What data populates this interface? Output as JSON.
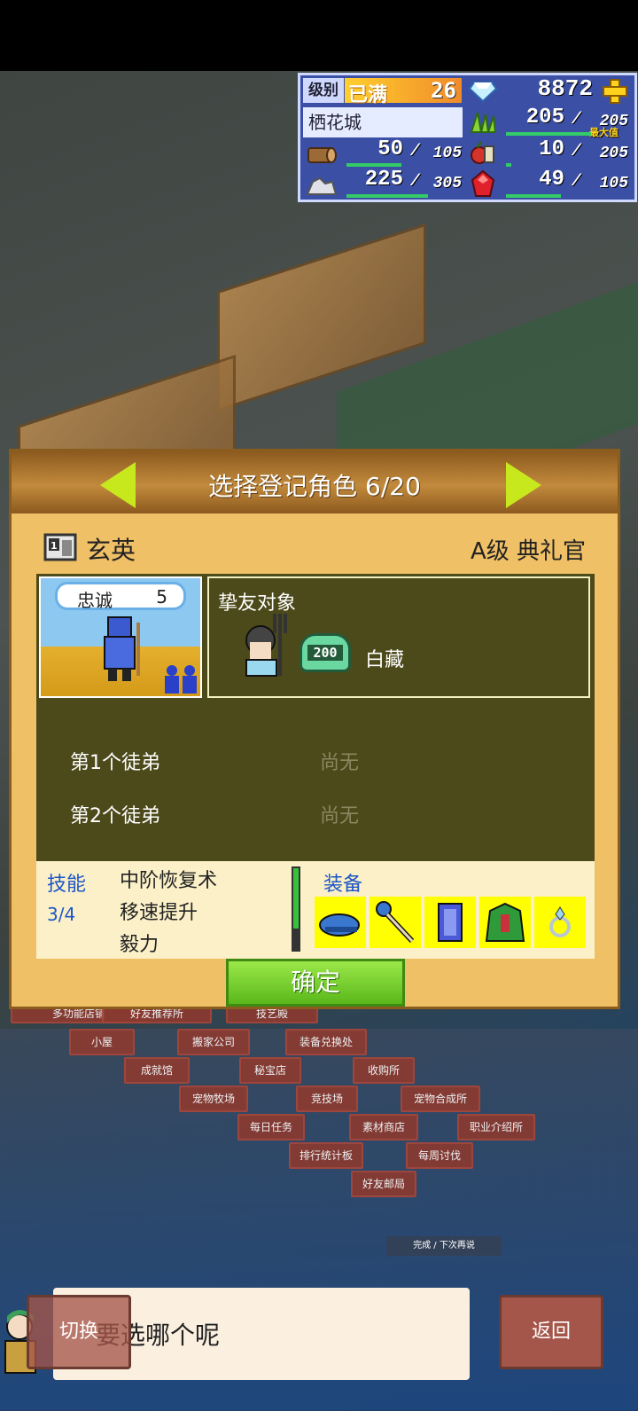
{
  "hud": {
    "level_label": "级别",
    "level_badge": "已满",
    "level_value": "26",
    "gems": "8872",
    "town_name": "栖花城",
    "grass_value": "205",
    "grass_max": "205",
    "max_label": "最大值",
    "wood_value": "50",
    "wood_max": "105",
    "food_value": "10",
    "food_max": "205",
    "stone_value": "225",
    "stone_max": "305",
    "ruby_value": "49",
    "ruby_max": "105",
    "slash": "/"
  },
  "dialog": {
    "title": "选择登记角色 6/20",
    "character_name": "玄英",
    "character_rank": "A级 典礼官",
    "card_number": "1",
    "loyalty_label": "忠诚",
    "loyalty_value": "5",
    "friend_label": "挚友对象",
    "friend_badge": "200",
    "friend_name": "白藏",
    "apprentices": [
      {
        "label": "第1个徒弟",
        "value": "尚无"
      },
      {
        "label": "第2个徒弟",
        "value": "尚无"
      }
    ],
    "skills_label": "技能",
    "skills_count": "3/4",
    "skills": [
      "中阶恢复术",
      "移速提升",
      "毅力"
    ],
    "equipment_label": "装备",
    "equipment_icons": [
      "blue-cap-icon",
      "magic-staff-icon",
      "blue-armor-icon",
      "green-robe-icon",
      "ring-icon"
    ],
    "confirm_label": "确定"
  },
  "map_tiles": [
    "小屋",
    "搬家公司",
    "装备兑换处",
    "成就馆",
    "秘宝店",
    "收购所",
    "宠物牧场",
    "竞技场",
    "宠物合成所",
    "每日任务",
    "素材商店",
    "职业介绍所",
    "排行统计板",
    "每周讨伐",
    "好友邮局"
  ],
  "map_tiles_partial": [
    "多功能店铺",
    "好友推荐所",
    "技艺殿"
  ],
  "map_footer": "完成 / 下次再说",
  "bottom": {
    "message": "要选哪个呢",
    "switch_label": "切换",
    "back_label": "返回"
  }
}
